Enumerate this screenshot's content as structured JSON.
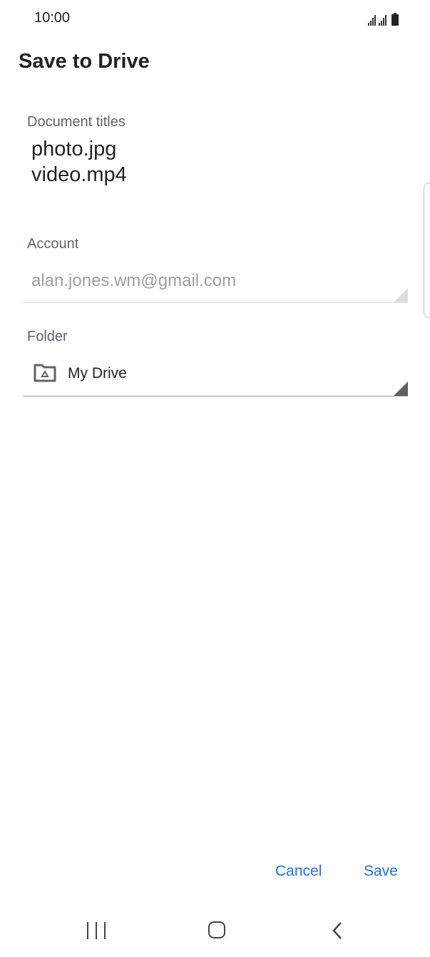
{
  "status_bar": {
    "time": "10:00",
    "icons": [
      "signal-icon",
      "signal-icon",
      "battery-icon"
    ]
  },
  "header": {
    "title": "Save to Drive"
  },
  "document_titles": {
    "label": "Document titles",
    "items": [
      "photo.jpg",
      "video.mp4"
    ]
  },
  "account": {
    "label": "Account",
    "value": "alan.jones.wm@gmail.com"
  },
  "folder": {
    "label": "Folder",
    "icon": "drive-folder-icon",
    "value": "My Drive"
  },
  "actions": {
    "cancel_label": "Cancel",
    "save_label": "Save"
  },
  "nav_bar": {
    "icons": [
      "recent-apps-icon",
      "home-icon",
      "back-icon"
    ]
  },
  "colors": {
    "accent": "#1a73e8",
    "label": "#5f6368",
    "disabled_text": "#9aa0a6"
  }
}
